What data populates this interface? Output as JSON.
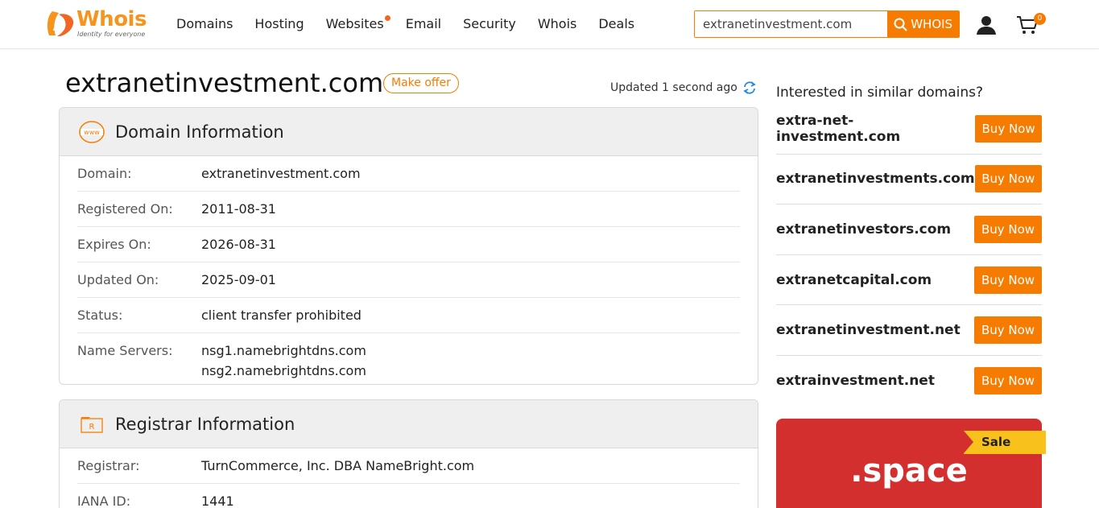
{
  "header": {
    "logo_word": "Whois",
    "logo_tagline": "Identity for everyone",
    "nav": [
      "Domains",
      "Hosting",
      "Websites",
      "Email",
      "Security",
      "Whois",
      "Deals"
    ],
    "search_value": "extranetinvestment.com",
    "search_button": "WHOIS",
    "cart_count": "0"
  },
  "title": {
    "domain": "extranetinvestment.com",
    "make_offer": "Make offer",
    "updated": "Updated 1 second ago"
  },
  "domain_info": {
    "heading": "Domain Information",
    "rows": [
      {
        "label": "Domain:",
        "value": "extranetinvestment.com"
      },
      {
        "label": "Registered On:",
        "value": "2011-08-31"
      },
      {
        "label": "Expires On:",
        "value": "2026-08-31"
      },
      {
        "label": "Updated On:",
        "value": "2025-09-01"
      },
      {
        "label": "Status:",
        "value": "client transfer prohibited"
      },
      {
        "label": "Name Servers:",
        "values": [
          "nsg1.namebrightdns.com",
          "nsg2.namebrightdns.com"
        ]
      }
    ]
  },
  "registrar_info": {
    "heading": "Registrar Information",
    "rows": [
      {
        "label": "Registrar:",
        "value": "TurnCommerce, Inc. DBA NameBright.com"
      },
      {
        "label": "IANA ID:",
        "value": "1441"
      }
    ]
  },
  "sidebar": {
    "title": "Interested in similar domains?",
    "buy_label": "Buy Now",
    "suggestions": [
      "extra-net-investment.com",
      "extranetinvestments.com",
      "extranetinvestors.com",
      "extranetcapital.com",
      "extranetinvestment.net",
      "extrainvestment.net"
    ],
    "promo": {
      "ribbon": "Sale",
      "tld": ".space",
      "color": "#d32f2f"
    }
  },
  "colors": {
    "accent": "#f57c00",
    "ribbon": "#f9c11c"
  }
}
